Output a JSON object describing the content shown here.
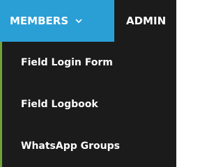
{
  "nav": {
    "members_label": "MEMBERS",
    "admin_label": "ADMIN",
    "members_icon": "chevron-down-icon"
  },
  "dropdown": {
    "items": [
      {
        "label": "Field Login Form"
      },
      {
        "label": "Field Logbook"
      },
      {
        "label": "WhatsApp Groups"
      }
    ]
  },
  "colors": {
    "active_tab": "#2a9fd6",
    "nav_background": "#1b1b1b",
    "menu_accent": "#6fa33a",
    "text": "#ffffff"
  }
}
